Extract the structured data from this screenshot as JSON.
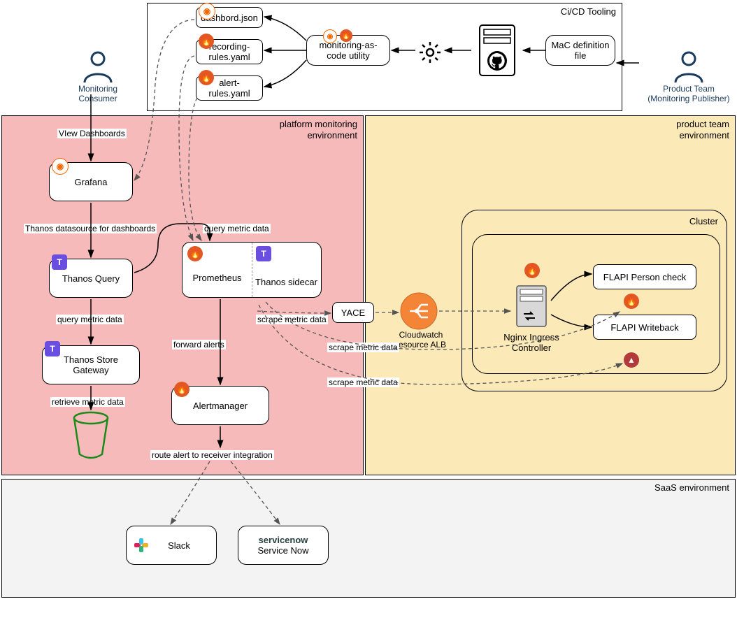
{
  "zones": {
    "cicd": "Ci/CD Tooling",
    "platform": "platform monitoring environment",
    "product": "product team environment",
    "saas": "SaaS environment",
    "cluster": "Cluster"
  },
  "actors": {
    "consumer": "Monitoring Consumer",
    "publisher_line1": "Product Team",
    "publisher_line2": "(Monitoring Publisher)"
  },
  "boxes": {
    "dashboard_json": "dashbord.json",
    "recording_rules": "recording-rules.yaml",
    "alert_rules": "alert-rules.yaml",
    "mac_utility": "monitoring-as-code utility",
    "mac_definition": "MaC definition file",
    "grafana": "Grafana",
    "thanos_query": "Thanos Query",
    "thanos_store": "Thanos Store Gateway",
    "prometheus": "Prometheus",
    "thanos_sidecar": "Thanos sidecar",
    "alertmanager": "Alertmanager",
    "yace": "YACE",
    "nginx": "Nginx Ingress Controller",
    "flapi_person": "FLAPI Person check",
    "flapi_writeback": "FLAPI Writeback",
    "slack": "Slack",
    "servicenow_label": "Service Now",
    "servicenow_brand": "servicenow",
    "cloudwatch": "Cloudwatch resource ALB"
  },
  "edges": {
    "view_dashboards": "VIew Dashboards",
    "thanos_ds": "Thanos datasource for dashboards",
    "query_metric_1": "query metric data",
    "query_metric_2": "query metric data",
    "retrieve_metric": "retrieve metric data",
    "forward_alerts": "forward alerts",
    "route_alert": "route alert to receiver integration",
    "scrape_1": "scrape metric data",
    "scrape_2": "scrape metric data",
    "scrape_3": "scrape metric data"
  }
}
